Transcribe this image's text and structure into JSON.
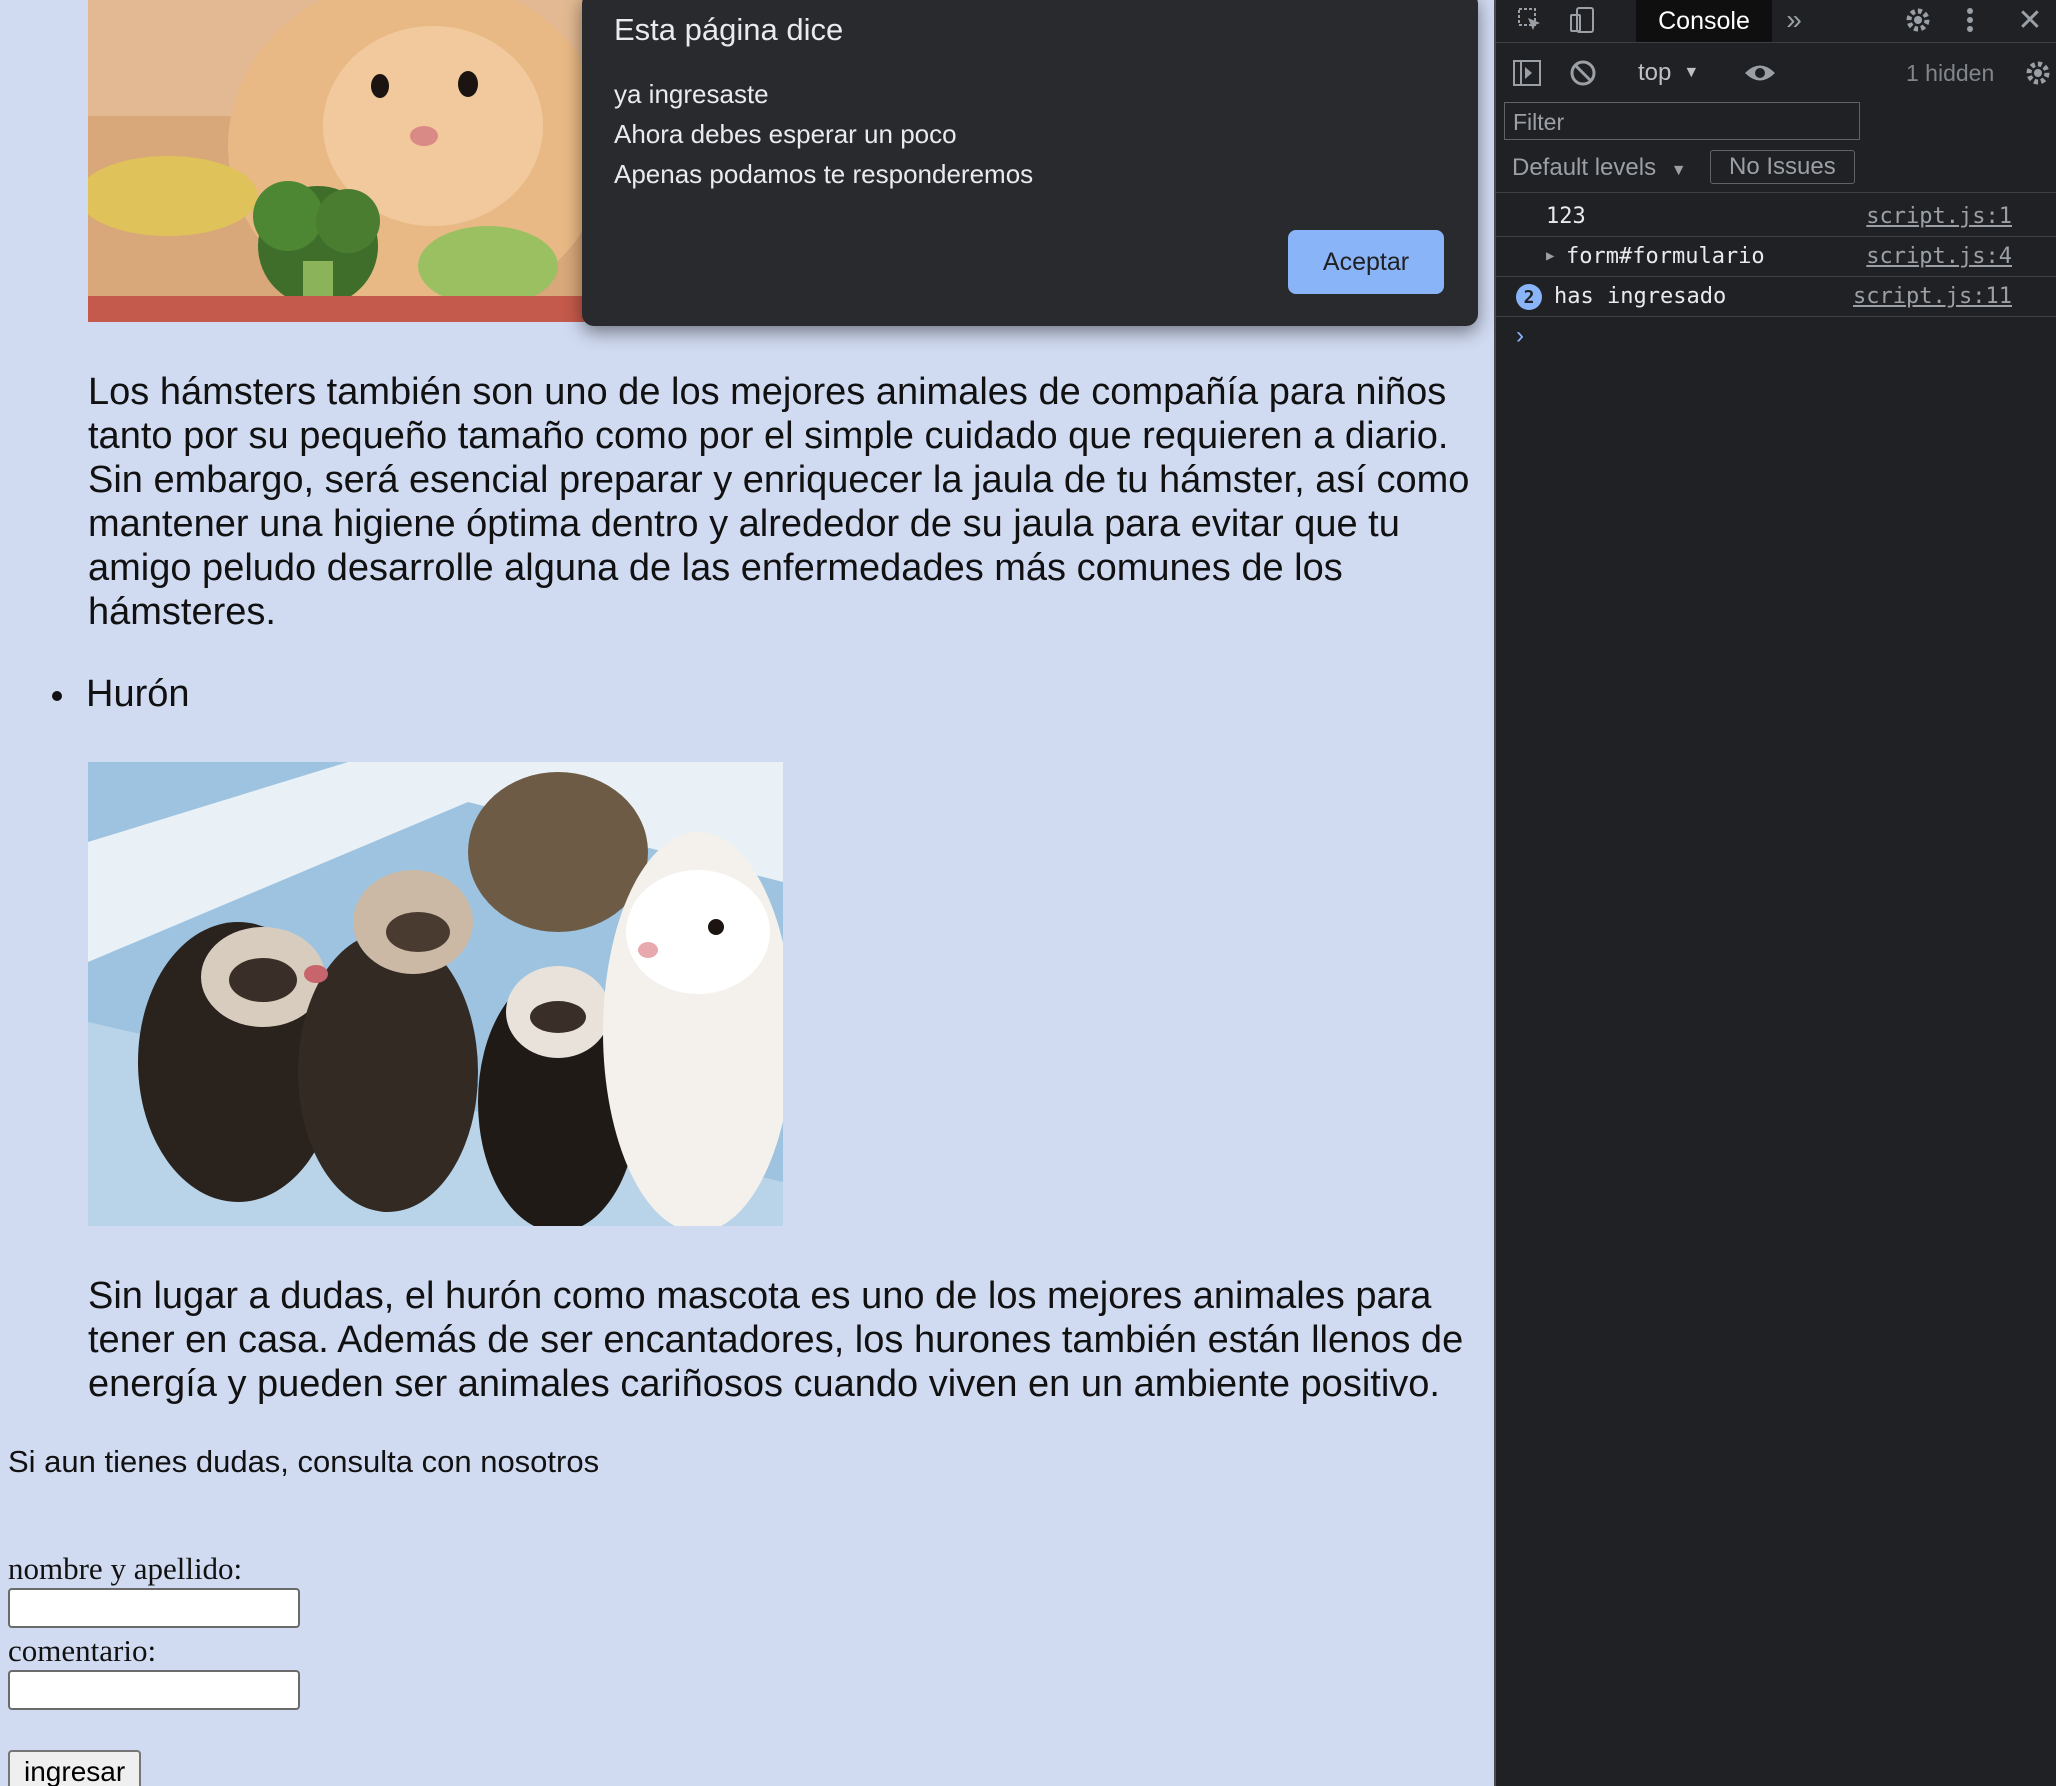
{
  "page": {
    "paragraph_hamster": "Los hámsters también son uno de los mejores animales de compañía para niños tanto por su pequeño tamaño como por el simple cuidado que requieren a diario. Sin embargo, será esencial preparar y enriquecer la jaula de tu hámster, así como mantener una higiene óptima dentro y alrededor de su jaula para evitar que tu amigo peludo desarrolle alguna de las enfermedades más comunes de los hámsteres.",
    "bullet_huron": "Hurón",
    "paragraph_huron": "Sin lugar a dudas, el hurón como mascota es uno de los mejores animales para tener en casa. Además de ser encantadores, los hurones también están llenos de energía y pueden ser animales cariñosos cuando viven en un ambiente positivo.",
    "cta": "Si aun tienes dudas, consulta con nosotros",
    "form": {
      "name_label": "nombre y apellido:",
      "name_value": "",
      "comment_label": "comentario:",
      "comment_value": "",
      "submit_label": "ingresar"
    },
    "background_color": "#d0daf1"
  },
  "dialog": {
    "title": "Esta página dice",
    "lines": [
      "ya ingresaste",
      "Ahora debes esperar un poco",
      "Apenas podamos te responderemos"
    ],
    "ok_label": "Aceptar"
  },
  "devtools": {
    "tab_console": "Console",
    "context": "top",
    "hidden": "1 hidden",
    "filter_placeholder": "Filter",
    "levels": "Default levels",
    "issues": "No Issues",
    "logs": [
      {
        "message": "123",
        "source": "script.js:1"
      },
      {
        "message": "form#formulario",
        "source": "script.js:4"
      },
      {
        "message": "has ingresado",
        "source": "script.js:11",
        "count": "2"
      }
    ],
    "accent_color": "#8ab4f8"
  }
}
